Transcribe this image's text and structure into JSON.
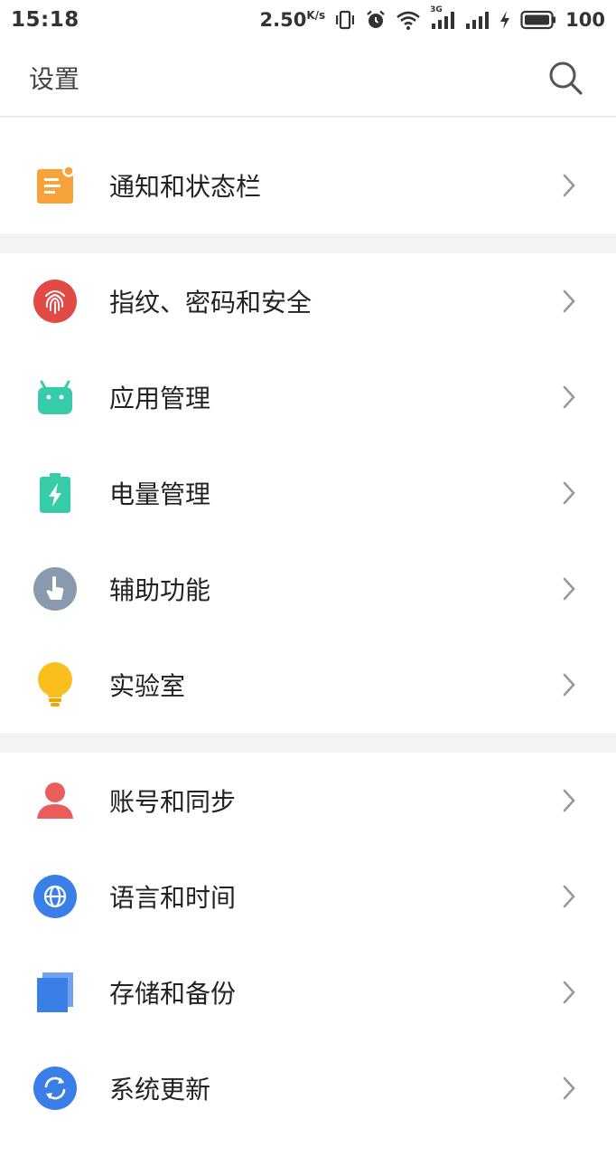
{
  "status_bar": {
    "time": "15:18",
    "net_speed_value": "2.50",
    "net_speed_unit": "K/s",
    "signal_label": "3G",
    "battery_level": "100"
  },
  "header": {
    "title": "设置"
  },
  "sections": [
    {
      "items": [
        {
          "label": "通知和状态栏",
          "icon": "notification-icon",
          "color": "#f7a23b"
        }
      ]
    },
    {
      "items": [
        {
          "label": "指纹、密码和安全",
          "icon": "fingerprint-icon",
          "color": "#e24a46"
        },
        {
          "label": "应用管理",
          "icon": "android-icon",
          "color": "#36cba9"
        },
        {
          "label": "电量管理",
          "icon": "battery-icon",
          "color": "#36cba9"
        },
        {
          "label": "辅助功能",
          "icon": "accessibility-icon",
          "color": "#8a9aae"
        },
        {
          "label": "实验室",
          "icon": "lightbulb-icon",
          "color": "#fbbf1d"
        }
      ]
    },
    {
      "items": [
        {
          "label": "账号和同步",
          "icon": "account-icon",
          "color": "#e95d5b"
        },
        {
          "label": "语言和时间",
          "icon": "globe-icon",
          "color": "#3a7ee8"
        },
        {
          "label": "存储和备份",
          "icon": "storage-icon",
          "color": "#3a7ee8"
        },
        {
          "label": "系统更新",
          "icon": "update-icon",
          "color": "#3a7ee8"
        }
      ]
    }
  ]
}
